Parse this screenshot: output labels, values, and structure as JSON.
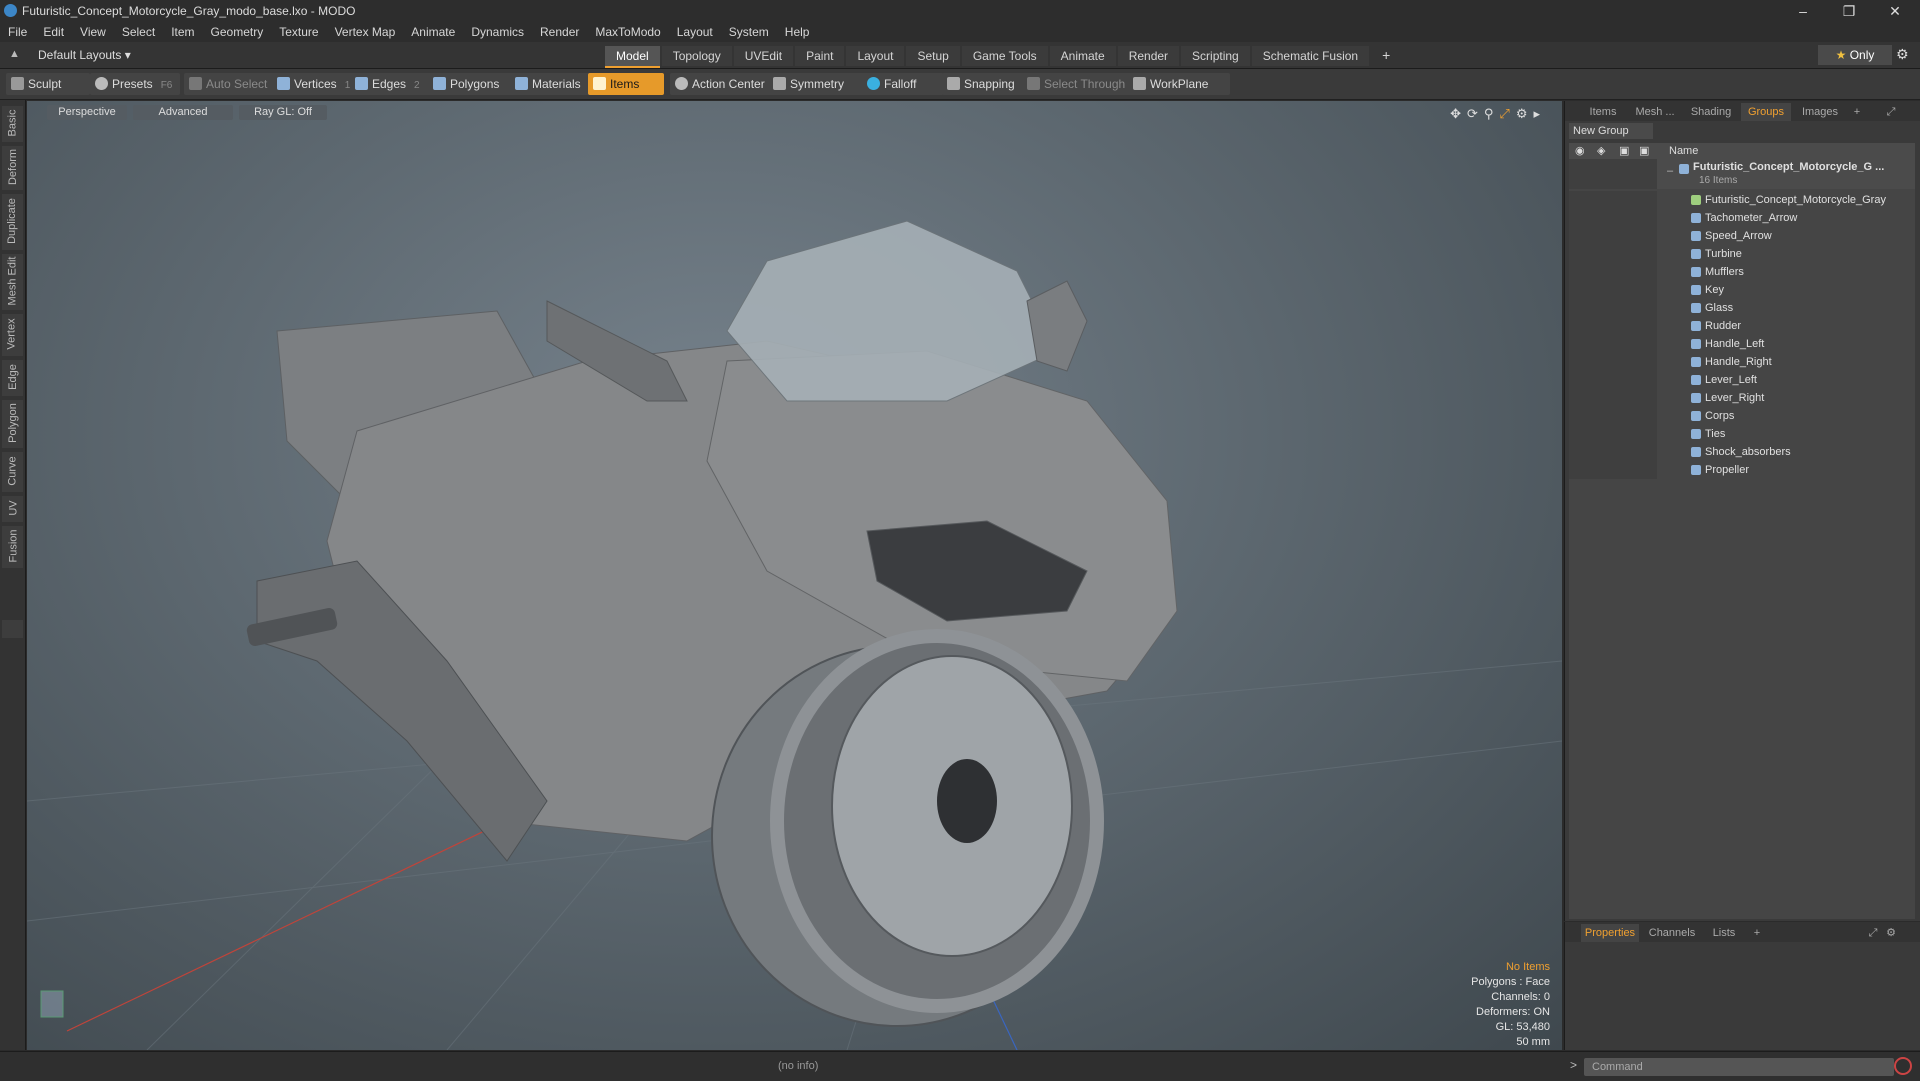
{
  "window": {
    "title": "Futuristic_Concept_Motorcycle_Gray_modo_base.lxo - MODO"
  },
  "menu": [
    "File",
    "Edit",
    "View",
    "Select",
    "Item",
    "Geometry",
    "Texture",
    "Vertex Map",
    "Animate",
    "Dynamics",
    "Render",
    "MaxToModo",
    "Layout",
    "System",
    "Help"
  ],
  "layouts": {
    "selected": "Default Layouts"
  },
  "top_tabs": [
    "Model",
    "Topology",
    "UVEdit",
    "Paint",
    "Layout",
    "Setup",
    "Game Tools",
    "Animate",
    "Render",
    "Scripting",
    "Schematic Fusion"
  ],
  "top_tab_active": "Model",
  "only_label": "Only",
  "toolbar": {
    "sculpt": "Sculpt",
    "presets": "Presets",
    "presets_key": "F6",
    "auto_select": "Auto Select",
    "vertices": "Vertices",
    "vertices_key": "1",
    "edges": "Edges",
    "edges_key": "2",
    "polygons": "Polygons",
    "materials": "Materials",
    "items": "Items",
    "action_center": "Action Center",
    "symmetry": "Symmetry",
    "falloff": "Falloff",
    "snapping": "Snapping",
    "select_through": "Select Through",
    "workplane": "WorkPlane"
  },
  "left_tabs": [
    "Basic",
    "Deform",
    "Duplicate",
    "Mesh Edit",
    "Vertex",
    "Edge",
    "Polygon",
    "Curve",
    "UV",
    "Fusion"
  ],
  "viewport": {
    "perspective": "Perspective",
    "advanced": "Advanced",
    "raygl": "Ray GL: Off",
    "readout": {
      "no_items": "No Items",
      "polygons": "Polygons : Face",
      "channels": "Channels: 0",
      "deformers": "Deformers: ON",
      "gl": "GL: 53,480",
      "focal": "50 mm"
    }
  },
  "right_panel": {
    "tabs": [
      "Items",
      "Mesh ...",
      "Shading",
      "Groups",
      "Images"
    ],
    "active_tab": "Groups",
    "new_group": "New Group",
    "col_name": "Name",
    "group_name": "Futuristic_Concept_Motorcycle_G ...",
    "group_count": "16 Items",
    "items": [
      "Futuristic_Concept_Motorcycle_Gray",
      "Tachometer_Arrow",
      "Speed_Arrow",
      "Turbine",
      "Mufflers",
      "Key",
      "Glass",
      "Rudder",
      "Handle_Left",
      "Handle_Right",
      "Lever_Left",
      "Lever_Right",
      "Corps",
      "Ties",
      "Shock_absorbers",
      "Propeller"
    ]
  },
  "bottom_panel": {
    "tabs": [
      "Properties",
      "Channels",
      "Lists"
    ],
    "active_tab": "Properties"
  },
  "status": {
    "info": "(no info)",
    "command_placeholder": "Command"
  },
  "colors": {
    "accent": "#e69a2a",
    "viewport_center": "#76828c",
    "panel": "#3a3a3a"
  }
}
